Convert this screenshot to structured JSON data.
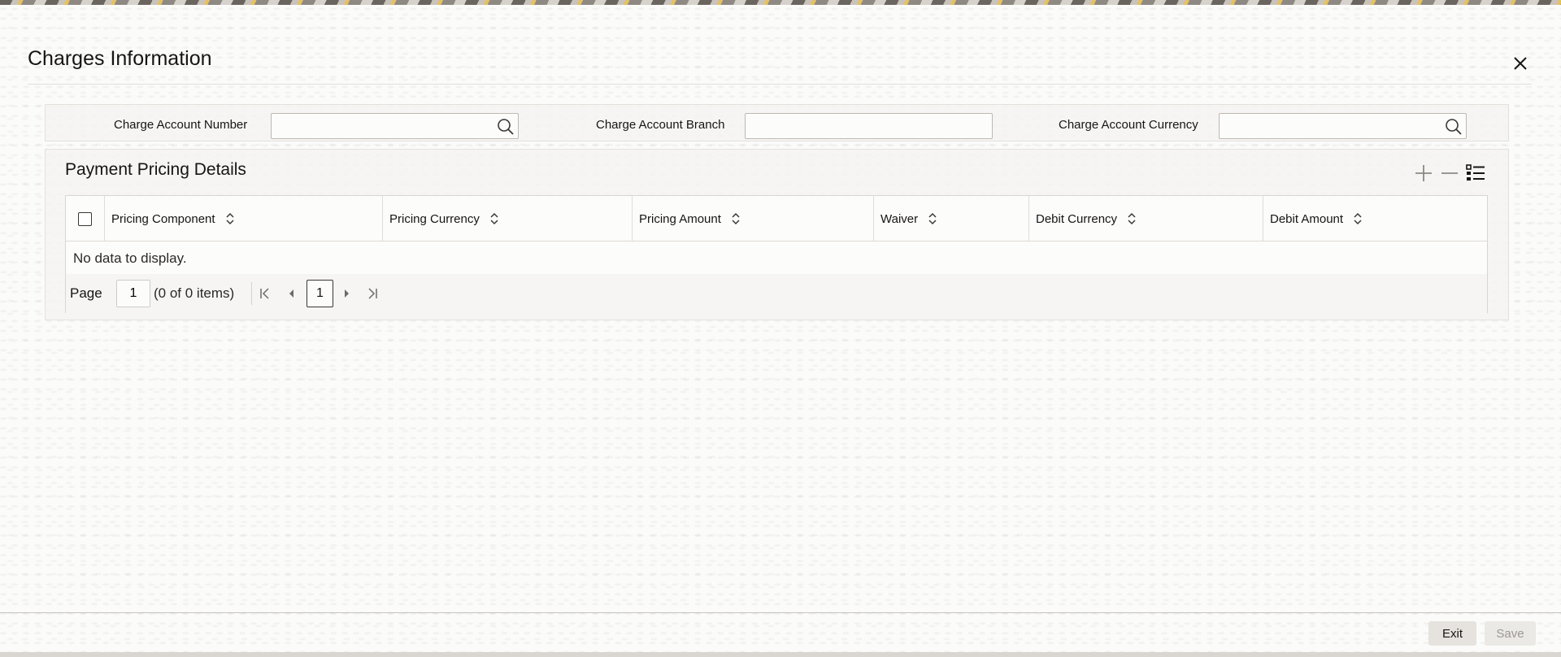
{
  "dialog": {
    "title": "Charges Information"
  },
  "fields": {
    "charge_account_number": {
      "label": "Charge Account Number",
      "value": ""
    },
    "charge_account_branch": {
      "label": "Charge Account Branch",
      "value": ""
    },
    "charge_account_currency": {
      "label": "Charge Account Currency",
      "value": ""
    }
  },
  "pricing": {
    "title": "Payment Pricing Details",
    "columns": [
      "Pricing Component",
      "Pricing Currency",
      "Pricing Amount",
      "Waiver",
      "Debit Currency",
      "Debit Amount"
    ],
    "empty_text": "No data to display.",
    "pager": {
      "label": "Page",
      "page_value": "1",
      "count_text": "(0 of 0 items)",
      "current_page": "1"
    }
  },
  "footer": {
    "exit_label": "Exit",
    "save_label": "Save"
  },
  "icons": {
    "close": "close-icon",
    "search": "search-icon",
    "add": "plus-icon",
    "remove": "minus-icon",
    "columns": "list-view-icon",
    "sort": "sort-icon",
    "first": "first-page-icon",
    "prev": "previous-page-icon",
    "next": "next-page-icon",
    "last": "last-page-icon"
  }
}
